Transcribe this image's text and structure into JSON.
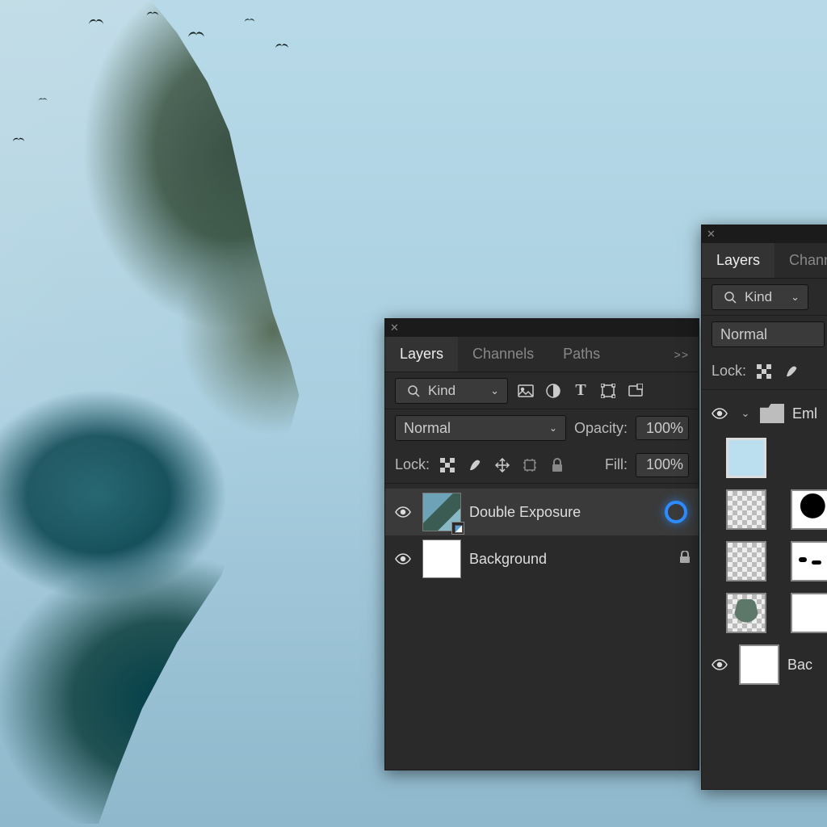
{
  "panel1": {
    "tabs": {
      "layers": "Layers",
      "channels": "Channels",
      "paths": "Paths"
    },
    "filter": {
      "kind_label": "Kind"
    },
    "blend": {
      "mode": "Normal",
      "opacity_label": "Opacity:",
      "opacity_value": "100%"
    },
    "lock": {
      "label": "Lock:",
      "fill_label": "Fill:",
      "fill_value": "100%"
    },
    "layers": [
      {
        "name": "Double Exposure"
      },
      {
        "name": "Background"
      }
    ]
  },
  "panel2": {
    "tabs": {
      "layers": "Layers",
      "channels": "Chann"
    },
    "filter": {
      "kind_label": "Kind"
    },
    "blend": {
      "mode": "Normal"
    },
    "lock": {
      "label": "Lock:"
    },
    "group": {
      "name": "Eml"
    },
    "bg_layer": {
      "name": "Bac"
    }
  }
}
